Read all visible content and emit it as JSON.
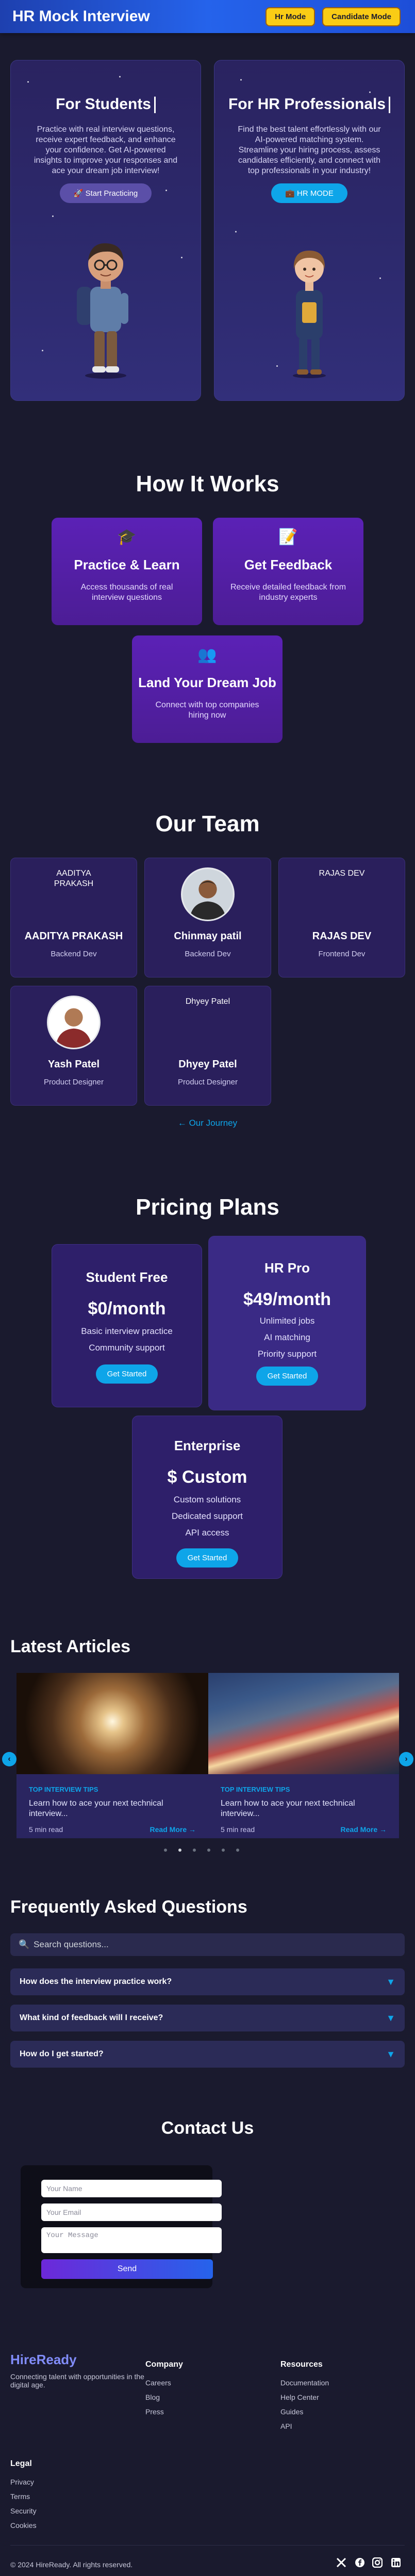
{
  "header": {
    "title": "HR Mock Interview",
    "hr_mode": "Hr Mode",
    "candidate_mode": "Candidate Mode"
  },
  "hero": {
    "students": {
      "title": "For Students",
      "description": "Practice with real interview questions, receive expert feedback, and enhance your confidence. Get AI-powered insights to improve your responses and ace your dream job interview!",
      "button": "Start Practicing"
    },
    "hr": {
      "title": "For HR Professionals",
      "description": "Find the best talent effortlessly with our AI-powered matching system. Streamline your hiring process, assess candidates efficiently, and connect with top professionals in your industry!",
      "button": "HR MODE"
    }
  },
  "how_it_works": {
    "title": "How It Works",
    "cards": [
      {
        "emoji": "🎓",
        "title": "Practice & Learn",
        "desc": "Access thousands of real interview questions"
      },
      {
        "emoji": "📝",
        "title": "Get Feedback",
        "desc": "Receive detailed feedback from industry experts"
      },
      {
        "emoji": "👥",
        "title": "Land Your Dream Job",
        "desc": "Connect with top companies hiring now"
      }
    ]
  },
  "team": {
    "title": "Our Team",
    "members": [
      {
        "alt": "AADITYA PRAKASH",
        "name": "AADITYA PRAKASH",
        "role": "Backend Dev"
      },
      {
        "alt": "",
        "name": "Chinmay patil",
        "role": "Backend Dev"
      },
      {
        "alt": "RAJAS DEV",
        "name": "RAJAS DEV",
        "role": "Frontend Dev"
      },
      {
        "alt": "",
        "name": "Yash Patel",
        "role": "Product Designer"
      },
      {
        "alt": "Dhyey Patel",
        "name": "Dhyey Patel",
        "role": "Product Designer"
      }
    ],
    "journey_link": "← Our Journey"
  },
  "pricing": {
    "title": "Pricing Plans",
    "plans": [
      {
        "name": "Student Free",
        "price": "$0/month",
        "features": [
          "Basic interview practice",
          "Community support"
        ],
        "button": "Get Started"
      },
      {
        "name": "HR Pro",
        "price": "$49/month",
        "features": [
          "Unlimited jobs",
          "AI matching",
          "Priority support"
        ],
        "button": "Get Started"
      },
      {
        "name": "Enterprise",
        "price": "$ Custom",
        "features": [
          "Custom solutions",
          "Dedicated support",
          "API access"
        ],
        "button": "Get Started"
      }
    ]
  },
  "articles": {
    "title": "Latest Articles",
    "items": [
      {
        "tag": "TOP INTERVIEW TIPS",
        "title": "Learn how to ace your next technical interview...",
        "read_time": "5 min read",
        "read_more": "Read More →"
      },
      {
        "tag": "TOP INTERVIEW TIPS",
        "title": "Learn how to ace your next technical interview...",
        "read_time": "5 min read",
        "read_more": "Read More →"
      }
    ],
    "prev": "‹",
    "next": "›"
  },
  "faq": {
    "title": "Frequently Asked Questions",
    "search_placeholder": "Search questions...",
    "items": [
      {
        "q": "How does the interview practice work?"
      },
      {
        "q": "What kind of feedback will I receive?"
      },
      {
        "q": "How do I get started?"
      }
    ]
  },
  "contact": {
    "title": "Contact Us",
    "name_placeholder": "Your Name",
    "email_placeholder": "Your Email",
    "message_placeholder": "Your Message",
    "send": "Send"
  },
  "footer": {
    "brand": "HireReady",
    "tagline": "Connecting talent with opportunities in the digital age.",
    "company": {
      "title": "Company",
      "links": [
        "Careers",
        "Blog",
        "Press"
      ]
    },
    "resources": {
      "title": "Resources",
      "links": [
        "Documentation",
        "Help Center",
        "Guides",
        "API"
      ]
    },
    "legal": {
      "title": "Legal",
      "links": [
        "Privacy",
        "Terms",
        "Security",
        "Cookies"
      ]
    },
    "copyright": "© 2024 HireReady. All rights reserved."
  },
  "colors": {
    "accent": "#0ea5e9",
    "mode_button": "#facc15",
    "background": "#1a1a2e",
    "brand": "#818cf8"
  }
}
